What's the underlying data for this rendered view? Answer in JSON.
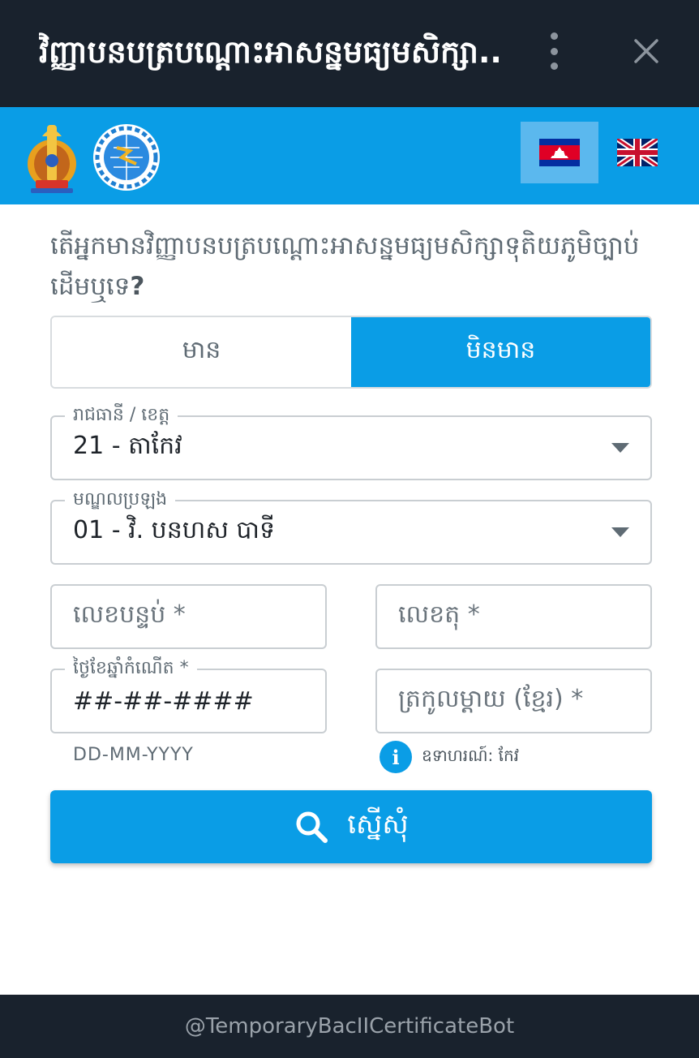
{
  "window": {
    "title": "វិញ្ញាបនបត្របណ្ដោះអាសន្នមធ្យមសិក្សា..",
    "menu_icon": "kebab-menu-icon",
    "close_icon": "close-icon"
  },
  "header": {
    "logos": [
      "ministry-emblem-icon",
      "ptc-logo-icon"
    ],
    "languages": [
      {
        "code": "km",
        "icon": "cambodia-flag-icon",
        "active": true
      },
      {
        "code": "en",
        "icon": "uk-flag-icon",
        "active": false
      }
    ]
  },
  "form": {
    "question": "តើអ្នកមានវិញ្ញាបនបត្របណ្ដោះអាសន្នមធ្យមសិក្សាទុតិយភូមិច្បាប់ដើមឬទេ",
    "question_mark": "?",
    "toggle": {
      "yes_label": "មាន",
      "no_label": "មិនមាន",
      "selected": "no"
    },
    "province": {
      "label": "រាជធានី / ខេត្ត",
      "value": "21 - តាកែវ"
    },
    "exam_center": {
      "label": "មណ្ឌលប្រឡង",
      "value": "01 - វិ. បនហស បាទី"
    },
    "room_number": {
      "placeholder": "លេខបន្ទប់ *"
    },
    "seat_number": {
      "placeholder": "លេខតុ *"
    },
    "date_of_birth": {
      "label": "ថ្ងៃខែឆ្នាំកំណើត *",
      "value": "##-##-####",
      "hint": "DD-MM-YYYY"
    },
    "mother_name": {
      "placeholder": "ត្រកូលម្ដាយ (ខ្មែរ) *",
      "example": "ឧទាហរណ៍: កែវ"
    },
    "submit_label": "ស្នើសុំ"
  },
  "footer": {
    "bot_handle": "@TemporaryBacIICertificateBot"
  },
  "colors": {
    "titlebar": "#19222d",
    "accent": "#0a9de6",
    "text_muted": "#5f6b74"
  }
}
